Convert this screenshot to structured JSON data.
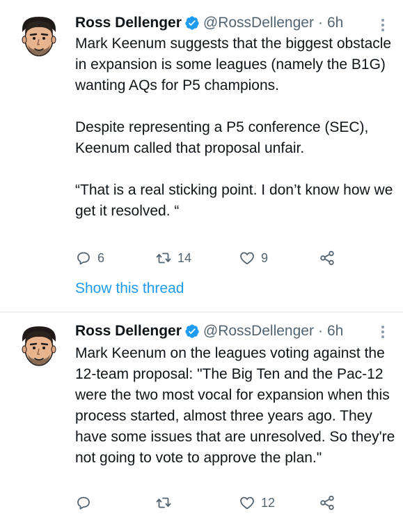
{
  "tweets": [
    {
      "author_name": "Ross Dellenger",
      "handle": "@RossDellenger",
      "separator": "·",
      "time": "6h",
      "paragraphs": [
        "Mark Keenum suggests that the biggest obstacle in expansion is some leagues (namely the B1G) wanting AQs for P5 champions.",
        "Despite representing a P5 conference (SEC), Keenum called that proposal unfair.",
        "“That is a real sticking point. I don’t know how we get it resolved. “"
      ],
      "reply_count": "6",
      "retweet_count": "14",
      "like_count": "9",
      "show_thread_label": "Show this thread"
    },
    {
      "author_name": "Ross Dellenger",
      "handle": "@RossDellenger",
      "separator": "·",
      "time": "6h",
      "paragraphs": [
        "Mark Keenum on the leagues voting against the 12-team proposal: \"The Big Ten and the Pac-12 were the two most vocal for expansion when this process started, almost three years ago. They have some issues that are unresolved. So they're not going to vote to approve the plan.\""
      ],
      "reply_count": "",
      "retweet_count": "",
      "like_count": "12"
    }
  ],
  "icons": {
    "reply": "reply-icon",
    "retweet": "retweet-icon",
    "like": "heart-icon",
    "share": "share-icon",
    "verified": "verified-badge-icon",
    "more": "more-options-icon"
  },
  "colors": {
    "text": "#0f1419",
    "muted": "#536471",
    "link": "#1d9bf0",
    "verified": "#1d9bf0",
    "separator": "#e1e6ea"
  }
}
